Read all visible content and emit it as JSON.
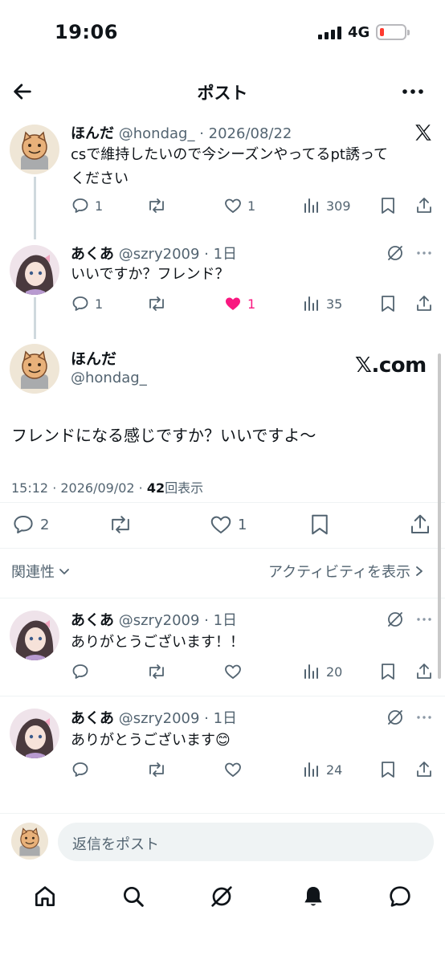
{
  "status": {
    "time": "19:06",
    "network": "4G"
  },
  "header": {
    "title": "ポスト",
    "back_icon": "arrow-left-icon",
    "more_icon": "ellipsis-icon"
  },
  "thread": [
    {
      "name": "ほんだ",
      "handle": "@hondag_",
      "date": "· 2026/08/22",
      "text_lines": [
        "csで維持したいので今シーズンやってるpt誘って",
        "ください"
      ],
      "reply_count": "1",
      "retweet_count": "",
      "like_count": "1",
      "view_count": "309"
    },
    {
      "name": "あくあ",
      "handle": "@szry2009",
      "date": "· 1日",
      "text_lines": [
        "いいですか？フレンド？"
      ],
      "reply_count": "1",
      "retweet_count": "",
      "like_count": "1",
      "like_active": true,
      "view_count": "35"
    }
  ],
  "main_post": {
    "name": "ほんだ",
    "handle": "@hondag_",
    "watermark": "𝕏.com",
    "text": "フレンドになる感じですか？いいですよ〜",
    "time": "15:12 · 2026/09/02 · ",
    "views_count": "42",
    "views_label": "回表示",
    "reply_count": "2",
    "like_count": "1"
  },
  "sort": {
    "label": "関連性",
    "activity_link": "アクティビティを表示"
  },
  "replies": [
    {
      "name": "あくあ",
      "handle": "@szry2009",
      "date": "· 1日",
      "text": "ありがとうございます！！",
      "view_count": "20"
    },
    {
      "name": "あくあ",
      "handle": "@szry2009",
      "date": "· 1日",
      "text": "ありがとうございます😊",
      "view_count": "24"
    }
  ],
  "reply_bar": {
    "placeholder": "返信をポスト"
  },
  "colors": {
    "text": "#0f1419",
    "muted": "#536471",
    "like": "#f91880",
    "divider": "#eff3f4"
  }
}
